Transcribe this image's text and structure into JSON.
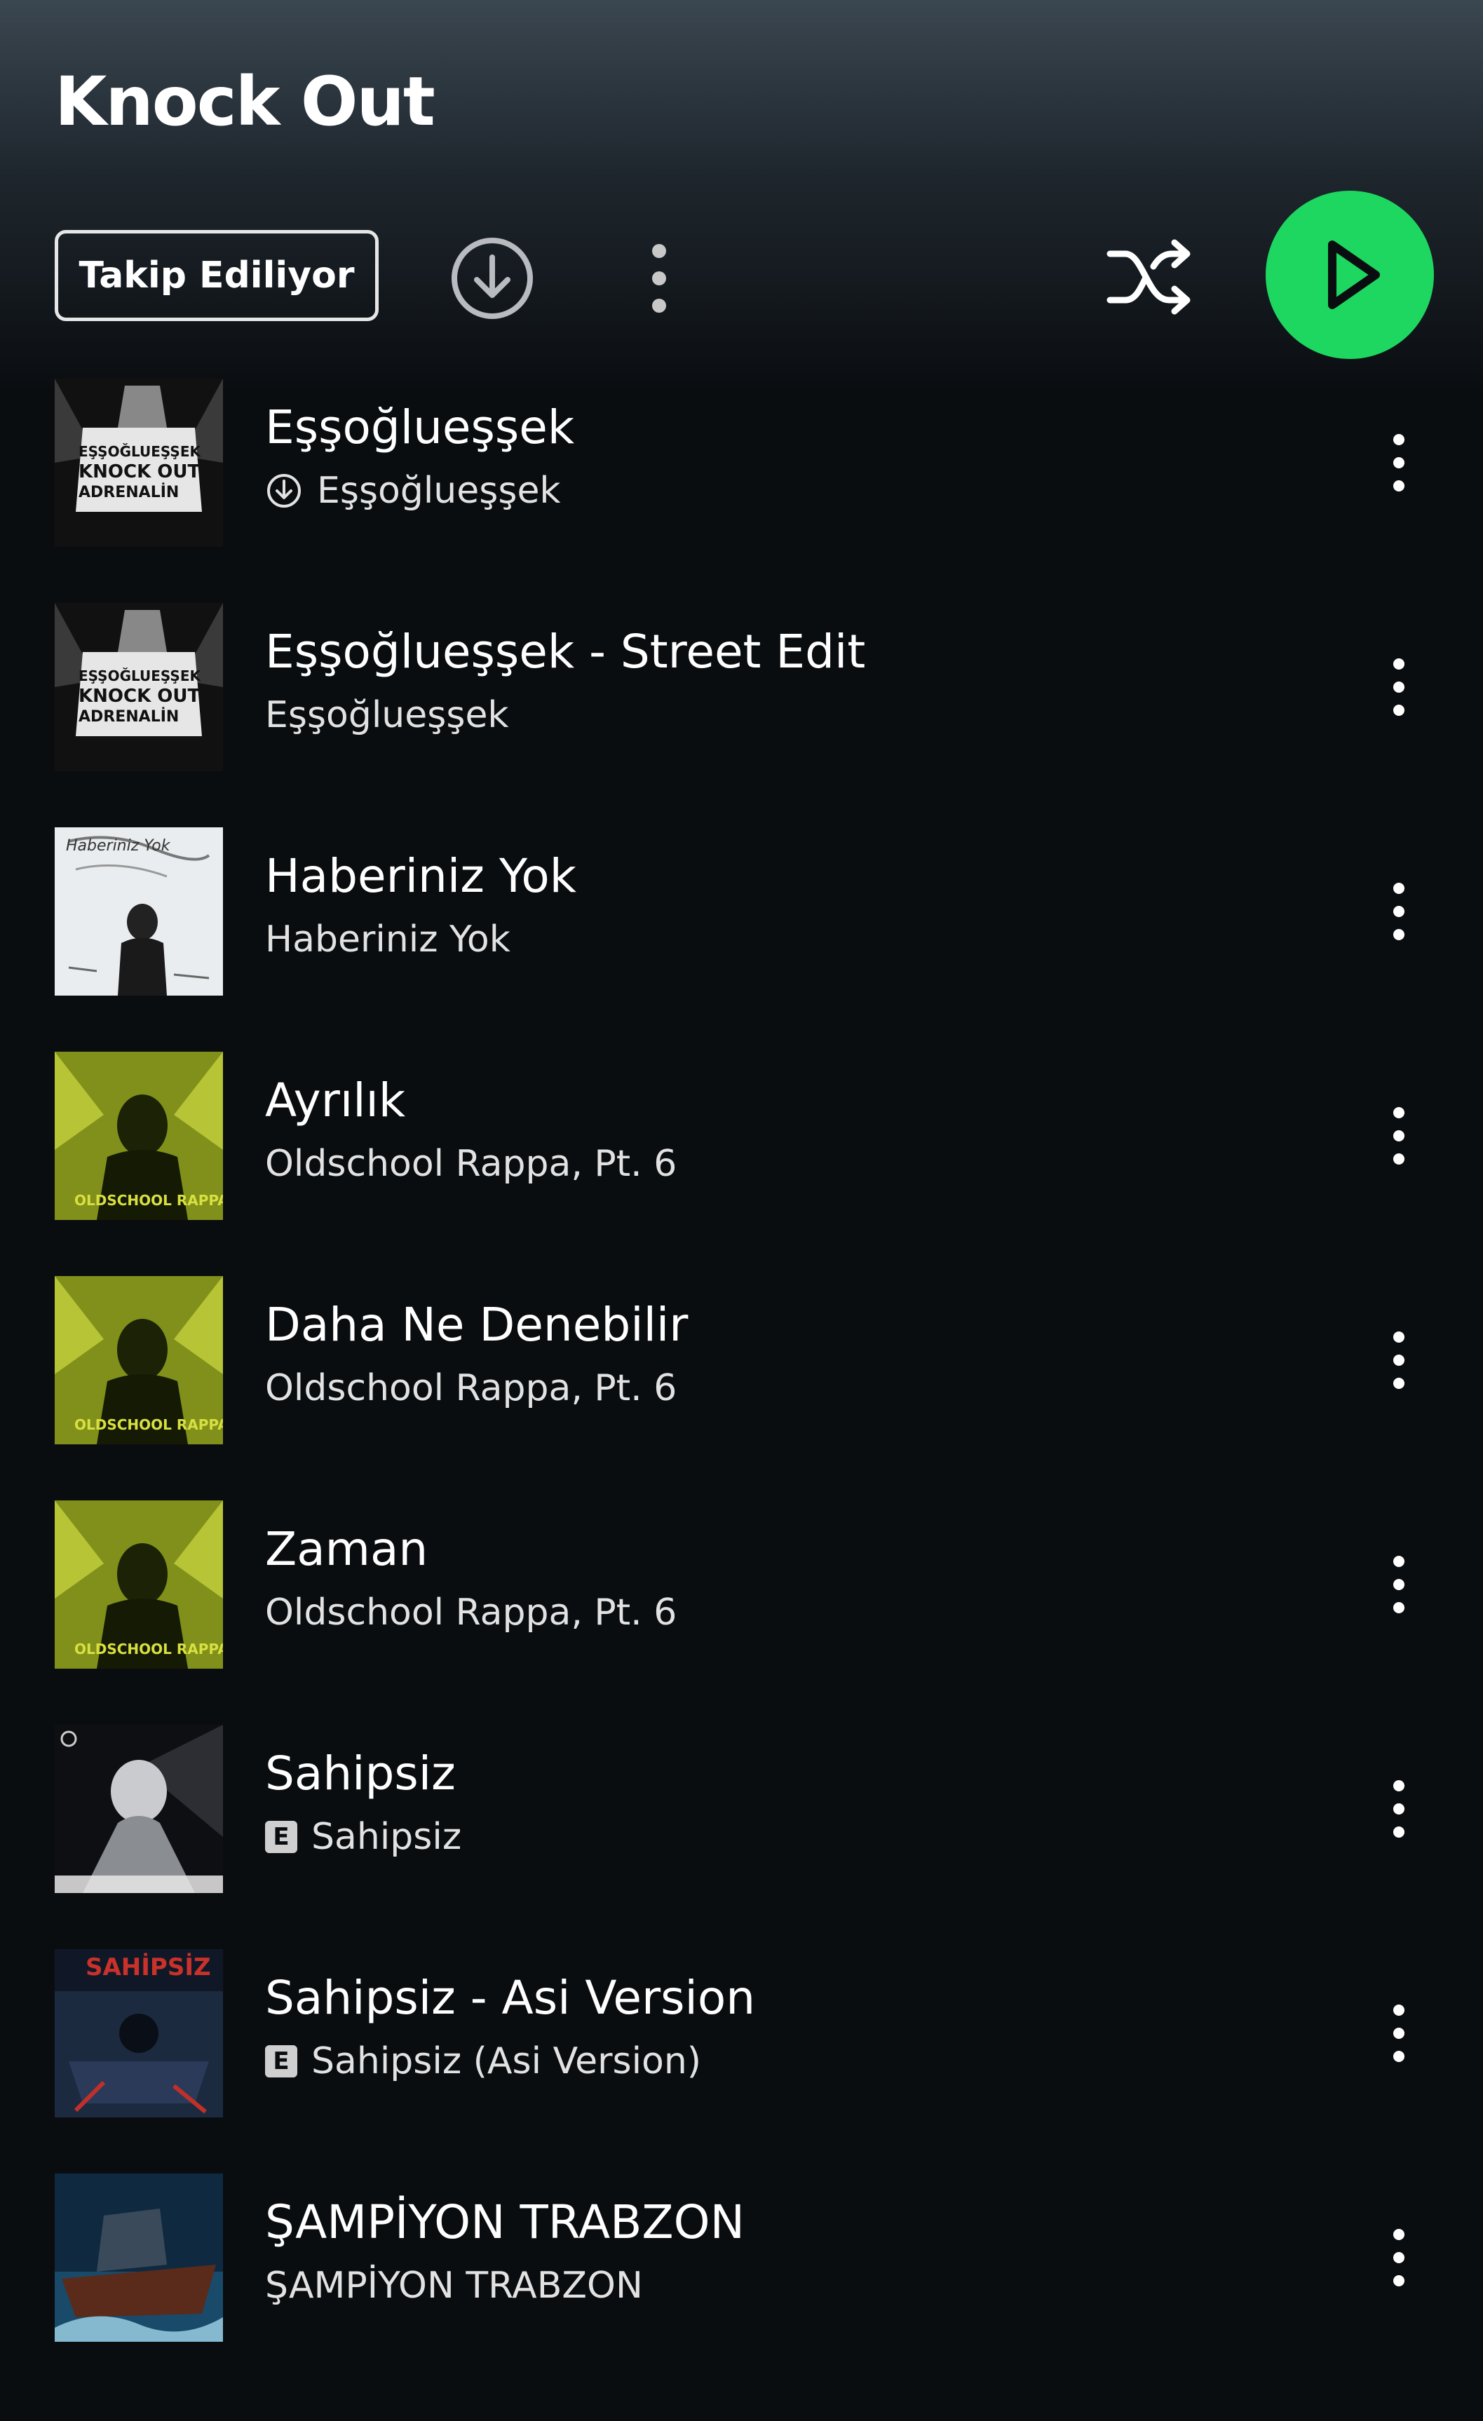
{
  "header": {
    "title": "Knock Out",
    "follow_label": "Takip Ediliyor"
  },
  "colors": {
    "accent": "#1ed760",
    "background": "#0a0d10"
  },
  "icons": {
    "download": "download-circle-icon",
    "more": "vertical-dots-icon",
    "shuffle": "shuffle-icon",
    "play": "play-icon",
    "explicit": "explicit-icon"
  },
  "cover_texts": {
    "essoglu_lines": [
      "EŞŞOĞLUEŞŞEK",
      "KNOCK OUT",
      "ADRENALİN"
    ],
    "oldschool": "OLDSCHOOL RAPPA",
    "habs": "Haberiniz Yok",
    "sahipsiz_asi": "SAHİPSİZ"
  },
  "tracks": [
    {
      "title": "Eşşoğlueşşek",
      "subtitle": "Eşşoğlueşşek",
      "badge": "download",
      "cover": "essoglu"
    },
    {
      "title": "Eşşoğlueşşek - Street Edit",
      "subtitle": "Eşşoğlueşşek",
      "badge": "",
      "cover": "essoglu"
    },
    {
      "title": "Haberiniz Yok",
      "subtitle": "Haberiniz Yok",
      "badge": "",
      "cover": "habs"
    },
    {
      "title": "Ayrılık",
      "subtitle": "Oldschool Rappa, Pt. 6",
      "badge": "",
      "cover": "oldschool"
    },
    {
      "title": "Daha Ne Denebilir",
      "subtitle": "Oldschool Rappa, Pt. 6",
      "badge": "",
      "cover": "oldschool"
    },
    {
      "title": "Zaman",
      "subtitle": "Oldschool Rappa, Pt. 6",
      "badge": "",
      "cover": "oldschool"
    },
    {
      "title": "Sahipsiz",
      "subtitle": "Sahipsiz",
      "badge": "E",
      "cover": "sahipsiz"
    },
    {
      "title": "Sahipsiz - Asi Version",
      "subtitle": "Sahipsiz (Asi Version)",
      "badge": "E",
      "cover": "sahipsiz_asi"
    },
    {
      "title": "ŞAMPİYON TRABZON",
      "subtitle": "ŞAMPİYON TRABZON",
      "badge": "",
      "cover": "trabzon"
    }
  ]
}
